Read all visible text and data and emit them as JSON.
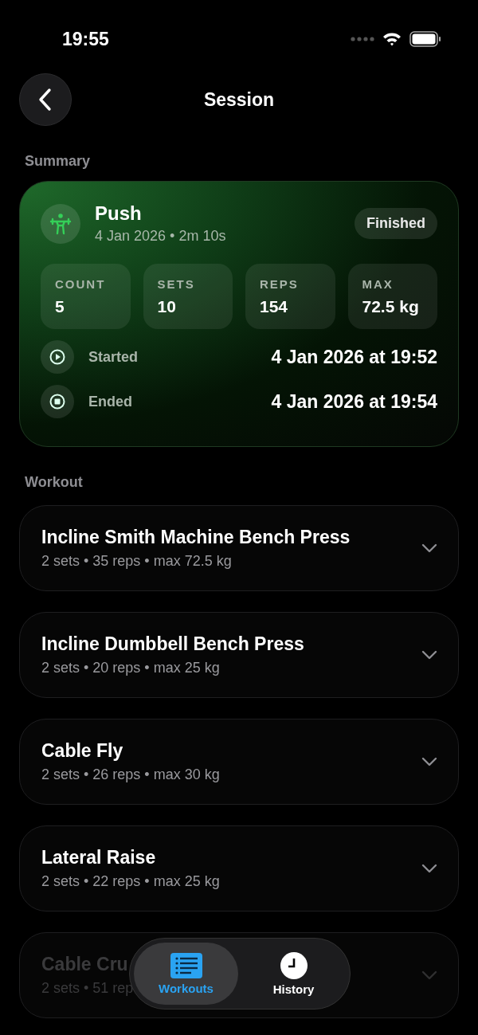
{
  "status_bar": {
    "time": "19:55"
  },
  "header": {
    "title": "Session"
  },
  "summary": {
    "label": "Summary",
    "workout": {
      "name": "Push",
      "meta": "4 Jan 2026 • 2m 10s",
      "status": "Finished"
    },
    "stats": [
      {
        "label": "COUNT",
        "value": "5"
      },
      {
        "label": "SETS",
        "value": "10"
      },
      {
        "label": "REPS",
        "value": "154"
      },
      {
        "label": "MAX",
        "value": "72.5 kg"
      }
    ],
    "times": [
      {
        "kind": "start",
        "label": "Started",
        "value": "4 Jan 2026 at 19:52"
      },
      {
        "kind": "end",
        "label": "Ended",
        "value": "4 Jan 2026 at 19:54"
      }
    ]
  },
  "workout": {
    "label": "Workout",
    "exercises": [
      {
        "name": "Incline Smith Machine Bench Press",
        "meta": "2 sets • 35 reps • max 72.5 kg",
        "expanded": false,
        "faded": false
      },
      {
        "name": "Incline Dumbbell Bench Press",
        "meta": "2 sets • 20 reps • max 25 kg",
        "expanded": false,
        "faded": false
      },
      {
        "name": "Cable Fly",
        "meta": "2 sets • 26 reps • max 30 kg",
        "expanded": false,
        "faded": false
      },
      {
        "name": "Lateral Raise",
        "meta": "2 sets • 22 reps • max 25 kg",
        "expanded": false,
        "faded": false
      },
      {
        "name": "Cable Cru",
        "meta": "2 sets • 51 rep",
        "expanded": false,
        "faded": true
      }
    ]
  },
  "tab_bar": [
    {
      "kind": "list",
      "label": "Workouts",
      "selected": true
    },
    {
      "kind": "clock",
      "label": "History",
      "selected": false
    }
  ]
}
